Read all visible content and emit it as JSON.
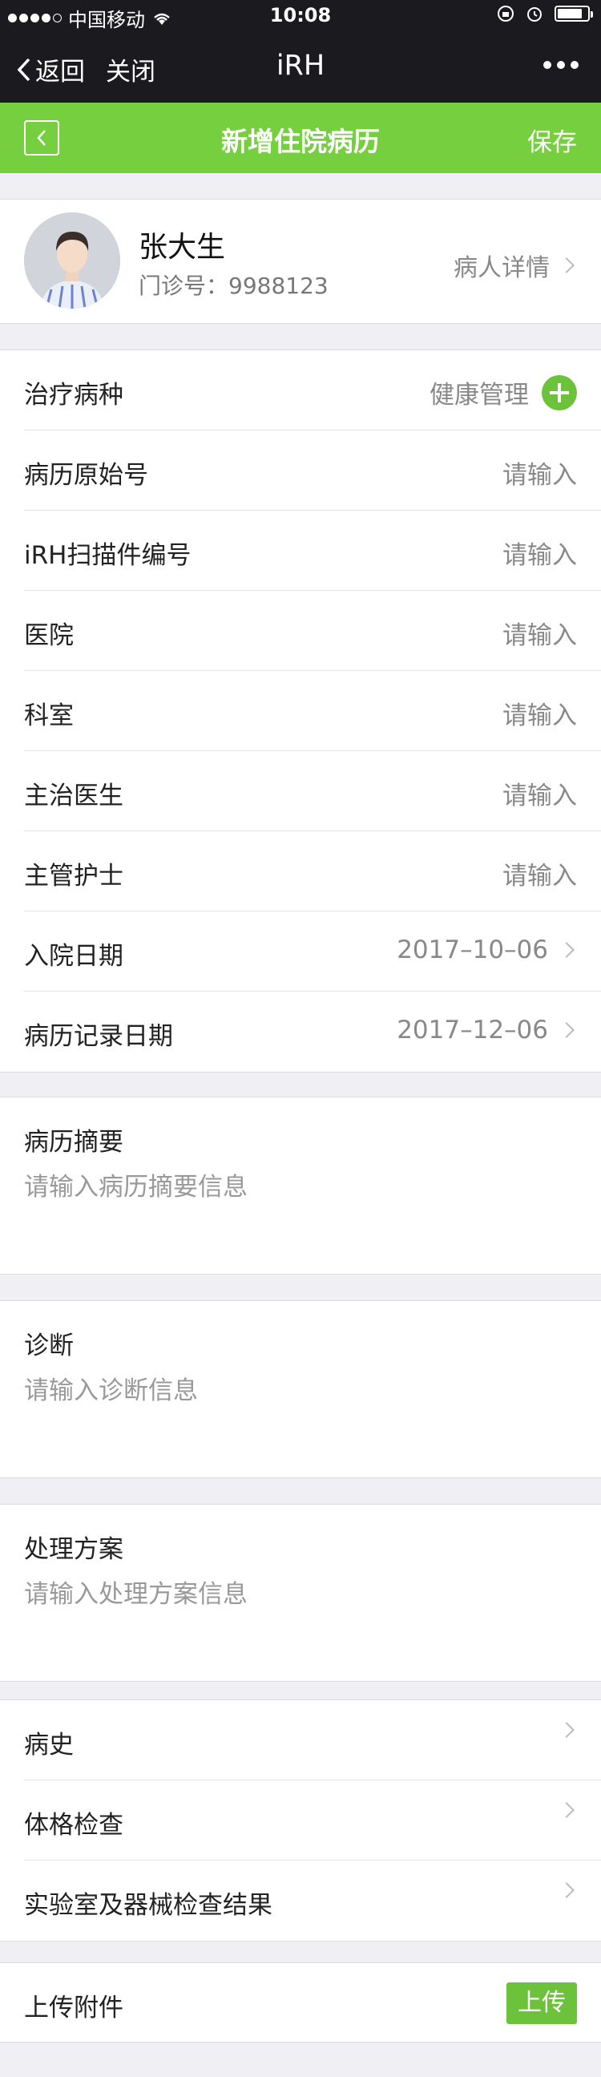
{
  "status_bar": {
    "carrier": "中国移动",
    "time": "10:08"
  },
  "nav": {
    "back_label": "返回",
    "close_label": "关闭",
    "title": "iRH"
  },
  "header": {
    "title": "新增住院病历",
    "save_label": "保存"
  },
  "patient": {
    "name": "张大生",
    "clinic_no": "门诊号：9988123",
    "detail_label": "病人详情"
  },
  "form": {
    "disease_type": {
      "label": "治疗病种",
      "value": "健康管理"
    },
    "record_original_no": {
      "label": "病历原始号",
      "placeholder": "请输入"
    },
    "irh_scan_no": {
      "label": "iRH扫描件编号",
      "placeholder": "请输入"
    },
    "hospital": {
      "label": "医院",
      "placeholder": "请输入"
    },
    "department": {
      "label": "科室",
      "placeholder": "请输入"
    },
    "attending_doctor": {
      "label": "主治医生",
      "placeholder": "请输入"
    },
    "head_nurse": {
      "label": "主管护士",
      "placeholder": "请输入"
    },
    "admission_date": {
      "label": "入院日期",
      "value": "2017–10–06"
    },
    "record_date": {
      "label": "病历记录日期",
      "value": "2017–12–06"
    }
  },
  "summary": {
    "title": "病历摘要",
    "placeholder": "请输入病历摘要信息"
  },
  "diagnosis": {
    "title": "诊断",
    "placeholder": "请输入诊断信息"
  },
  "treatment": {
    "title": "处理方案",
    "placeholder": "请输入处理方案信息"
  },
  "links": {
    "history": "病史",
    "physical_exam": "体格检查",
    "lab_results": "实验室及器械检查结果"
  },
  "attachment": {
    "label": "上传附件",
    "upload_label": "上传"
  },
  "colors": {
    "brand_green": "#76cf3e",
    "nav_dark": "#1b1b1f"
  }
}
